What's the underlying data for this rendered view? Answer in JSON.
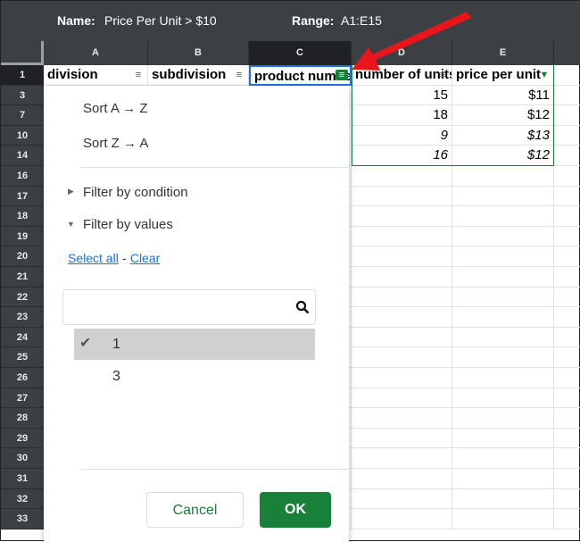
{
  "topbar": {
    "name_label": "Name:",
    "name_value": "Price Per Unit > $10",
    "range_label": "Range:",
    "range_value": "A1:E15"
  },
  "columns": [
    "A",
    "B",
    "C",
    "D",
    "E"
  ],
  "rows": [
    "1",
    "3",
    "7",
    "10",
    "14",
    "16",
    "17",
    "18",
    "19",
    "20",
    "21",
    "22",
    "23",
    "24",
    "25",
    "26",
    "27",
    "28",
    "29",
    "30",
    "31",
    "32",
    "33"
  ],
  "headers": [
    "division",
    "subdivision",
    "product number",
    "number of units",
    "price per unit"
  ],
  "data_rows": [
    [
      "15",
      "$11"
    ],
    [
      "18",
      "$12"
    ],
    [
      "9",
      "$13"
    ],
    [
      "16",
      "$12"
    ]
  ],
  "menu": {
    "sort_az": "Sort A → Z",
    "sort_za": "Sort Z → A",
    "filter_condition": "Filter by condition",
    "filter_values": "Filter by values",
    "select_all": "Select all",
    "sep": "-",
    "clear": "Clear",
    "values": [
      {
        "label": "1",
        "checked": true
      },
      {
        "label": "3",
        "checked": false
      }
    ],
    "cancel": "Cancel",
    "ok": "OK"
  },
  "colors": {
    "accent": "#188038",
    "arrow": "#e8151b",
    "link": "#1a73e8"
  }
}
